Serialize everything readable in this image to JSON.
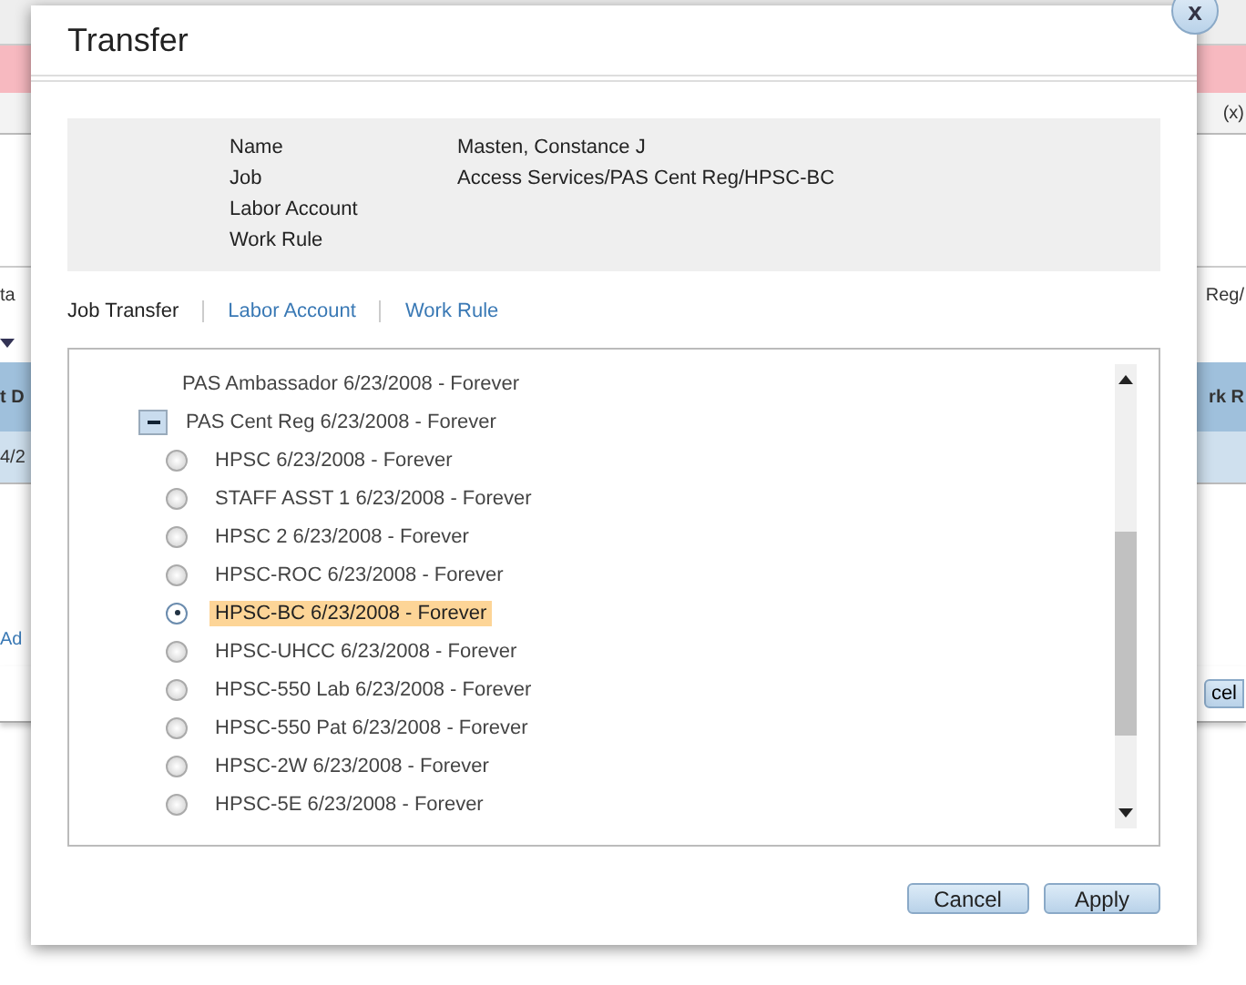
{
  "background": {
    "total_text": "(x)",
    "left_field": "ta",
    "right_text": "Reg/",
    "column_left": "t D",
    "column_right": "rk R",
    "cell_left": "4/2",
    "add_link": "Ad",
    "cancel_button": "cel"
  },
  "dialog": {
    "title": "Transfer",
    "info": [
      {
        "label": "Name",
        "value": "Masten, Constance J"
      },
      {
        "label": "Job",
        "value": "Access Services/PAS Cent Reg/HPSC-BC"
      },
      {
        "label": "Labor Account"
      },
      {
        "label": "Work Rule"
      }
    ],
    "tabs": [
      {
        "label": "Job Transfer",
        "selected": true
      },
      {
        "label": "Labor Account",
        "selected": false
      },
      {
        "label": "Work Rule",
        "selected": false
      }
    ],
    "tree": [
      {
        "kind": "plain",
        "label": "PAS Ambassador 6/23/2008 - Forever"
      },
      {
        "kind": "group",
        "label": "PAS Cent Reg 6/23/2008 - Forever",
        "expanded": true,
        "children": [
          {
            "label": "HPSC 6/23/2008 - Forever",
            "selected": false
          },
          {
            "label": "STAFF ASST 1 6/23/2008 - Forever",
            "selected": false
          },
          {
            "label": "HPSC 2 6/23/2008 - Forever",
            "selected": false
          },
          {
            "label": "HPSC-ROC 6/23/2008 - Forever",
            "selected": false
          },
          {
            "label": "HPSC-BC 6/23/2008 - Forever",
            "selected": true
          },
          {
            "label": "HPSC-UHCC 6/23/2008 - Forever",
            "selected": false
          },
          {
            "label": "HPSC-550 Lab 6/23/2008 - Forever",
            "selected": false
          },
          {
            "label": "HPSC-550 Pat 6/23/2008 - Forever",
            "selected": false
          },
          {
            "label": "HPSC-2W 6/23/2008 - Forever",
            "selected": false
          },
          {
            "label": "HPSC-5E 6/23/2008 - Forever",
            "selected": false
          }
        ]
      }
    ],
    "buttons": [
      "Cancel",
      "Apply"
    ],
    "close_label": "x"
  }
}
